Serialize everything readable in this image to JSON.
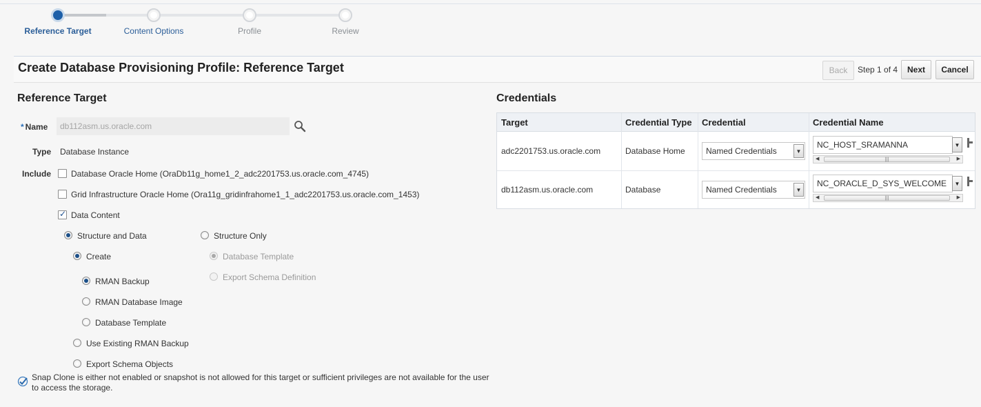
{
  "train": {
    "steps": [
      {
        "label": "Reference Target",
        "state": "active"
      },
      {
        "label": "Content Options",
        "state": "link"
      },
      {
        "label": "Profile",
        "state": "disabled"
      },
      {
        "label": "Review",
        "state": "disabled"
      }
    ]
  },
  "header": {
    "title": "Create Database Provisioning Profile: Reference Target",
    "back_label": "Back",
    "step_text": "Step 1 of 4",
    "next_label": "Next",
    "cancel_label": "Cancel"
  },
  "reference_target": {
    "heading": "Reference Target",
    "name_required_mark": "*",
    "name_label": "Name",
    "name_value": "db112asm.us.oracle.com",
    "type_label": "Type",
    "type_value": "Database Instance",
    "include_label": "Include",
    "include_options": [
      {
        "label": "Database Oracle Home (OraDb11g_home1_2_adc2201753.us.oracle.com_4745)",
        "checked": false
      },
      {
        "label": "Grid Infrastructure Oracle Home (Ora11g_gridinfrahome1_1_adc2201753.us.oracle.com_1453)",
        "checked": false
      },
      {
        "label": "Data Content",
        "checked": true
      }
    ],
    "structure_and_data": "Structure and Data",
    "structure_only": "Structure Only",
    "create": "Create",
    "rman_backup": "RMAN Backup",
    "rman_database_image": "RMAN Database Image",
    "database_template": "Database Template",
    "use_existing_rman_backup": "Use Existing RMAN Backup",
    "export_schema_objects": "Export Schema Objects",
    "so_database_template": "Database Template",
    "so_export_schema_definition": "Export Schema Definition",
    "snap_clone_message": "Snap Clone is either not enabled or snapshot is not allowed for this target or sufficient privileges are not available for the user to access the storage."
  },
  "credentials": {
    "heading": "Credentials",
    "columns": [
      "Target",
      "Credential Type",
      "Credential",
      "Credential Name"
    ],
    "rows": [
      {
        "target": "adc2201753.us.oracle.com",
        "credential_type": "Database Home",
        "credential": "Named Credentials",
        "credential_name": "NC_HOST_SRAMANNA"
      },
      {
        "target": "db112asm.us.oracle.com",
        "credential_type": "Database",
        "credential": "Named Credentials",
        "credential_name": "NC_ORACLE_D_SYS_WELCOME"
      }
    ]
  },
  "colors": {
    "accent": "#1d5fa8",
    "link": "#2a5d98",
    "background": "#f6f6f6"
  }
}
